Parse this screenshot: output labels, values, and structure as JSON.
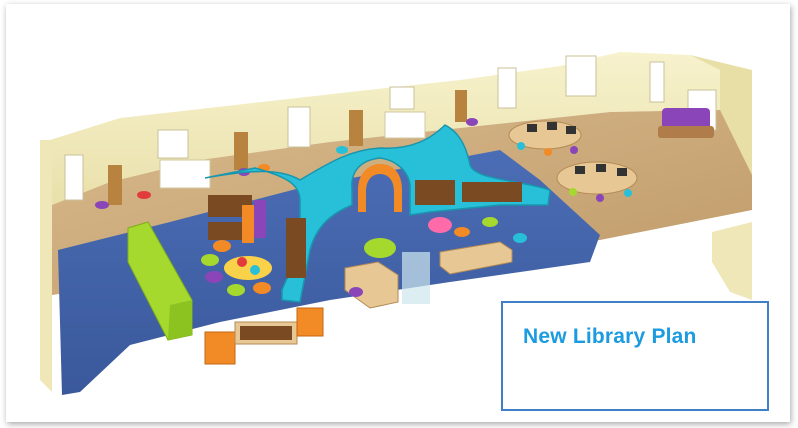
{
  "caption": {
    "text": "New Library Plan"
  },
  "colors": {
    "carpet": "#3d5fa6",
    "floor_wood": "#c9a678",
    "walls": "#f4eec0",
    "shelving": "#28c0d8",
    "accent_green": "#a6d92e",
    "accent_orange": "#f28a25",
    "accent_purple": "#8a45b8",
    "caption_text": "#1c9be0",
    "caption_border": "#3f7fc6"
  }
}
